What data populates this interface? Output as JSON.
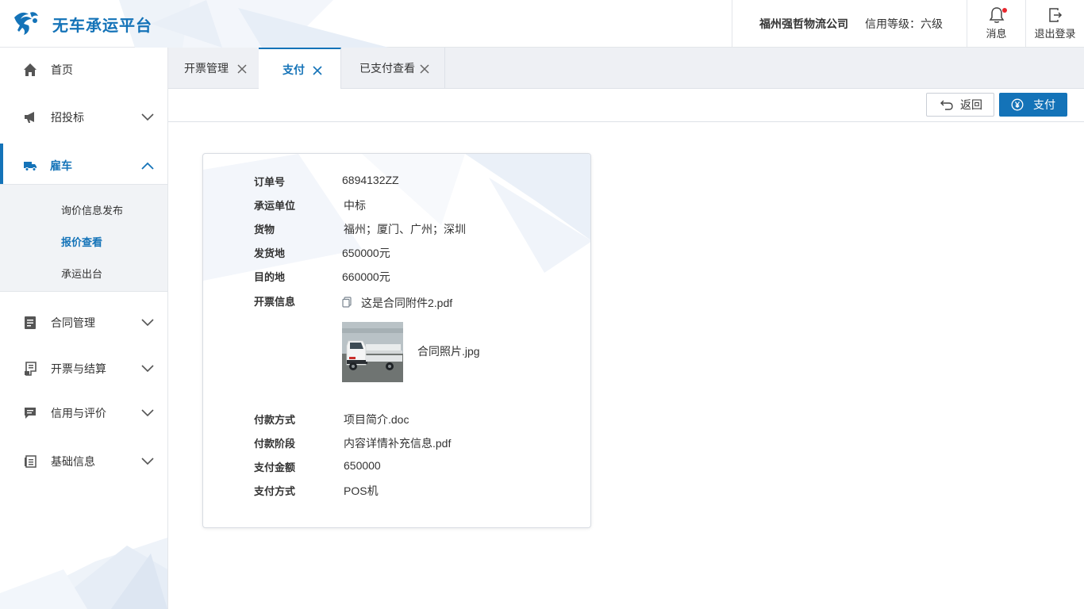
{
  "app": {
    "title": "无车承运平台"
  },
  "header": {
    "company": "福州强哲物流公司",
    "credit_level": "信用等级：六级",
    "messages_label": "消息",
    "logout_label": "退出登录"
  },
  "sidebar": {
    "items": [
      {
        "label": "首页"
      },
      {
        "label": "招投标"
      },
      {
        "label": "雇车"
      },
      {
        "label": "合同管理"
      },
      {
        "label": "开票与结算"
      },
      {
        "label": "信用与评价"
      },
      {
        "label": "基础信息"
      }
    ],
    "submenu": [
      {
        "label": "询价信息发布"
      },
      {
        "label": "报价查看"
      },
      {
        "label": "承运出台"
      }
    ]
  },
  "tabs": [
    {
      "label": "开票管理"
    },
    {
      "label": "支付"
    },
    {
      "label": "已支付查看"
    }
  ],
  "toolbar": {
    "back_label": "返回",
    "pay_label": "支付"
  },
  "details": {
    "order_no_label": "订单号",
    "order_no": "6894132ZZ",
    "carrier_label": "承运单位",
    "carrier": "中标",
    "goods_label": "货物",
    "goods": "福州；厦门、广州；深圳",
    "origin_label": "发货地",
    "origin": "650000元",
    "destination_label": "目的地",
    "destination": "660000元",
    "invoice_label": "开票信息",
    "invoice_file": "这是合同附件2.pdf",
    "photo_file": "合同照片.jpg",
    "payment_method_label": "付款方式",
    "payment_method": "项目简介.doc",
    "payment_stage_label": "付款阶段",
    "payment_stage": "内容详情补充信息.pdf",
    "amount_label": "支付金额",
    "amount": "650000",
    "pay_way_label": "支付方式",
    "pay_way": "POS机"
  },
  "colors": {
    "accent": "#1473b8",
    "notification_dot": "#e8262d",
    "tab_bar_bg": "#eef0f4",
    "submenu_bg": "#f1f3f6"
  },
  "icons": {
    "logo": "pegasus-logo-icon",
    "home": "home-icon",
    "bidding": "megaphone-icon",
    "hire": "truck-icon",
    "contract": "document-list-icon",
    "invoice": "receipt-icon",
    "credit": "comment-icon",
    "basic": "archive-icon",
    "bell": "bell-icon",
    "logout": "logout-icon",
    "attachment": "copy-file-icon",
    "pay": "yen-circle-icon",
    "back": "undo-icon"
  }
}
